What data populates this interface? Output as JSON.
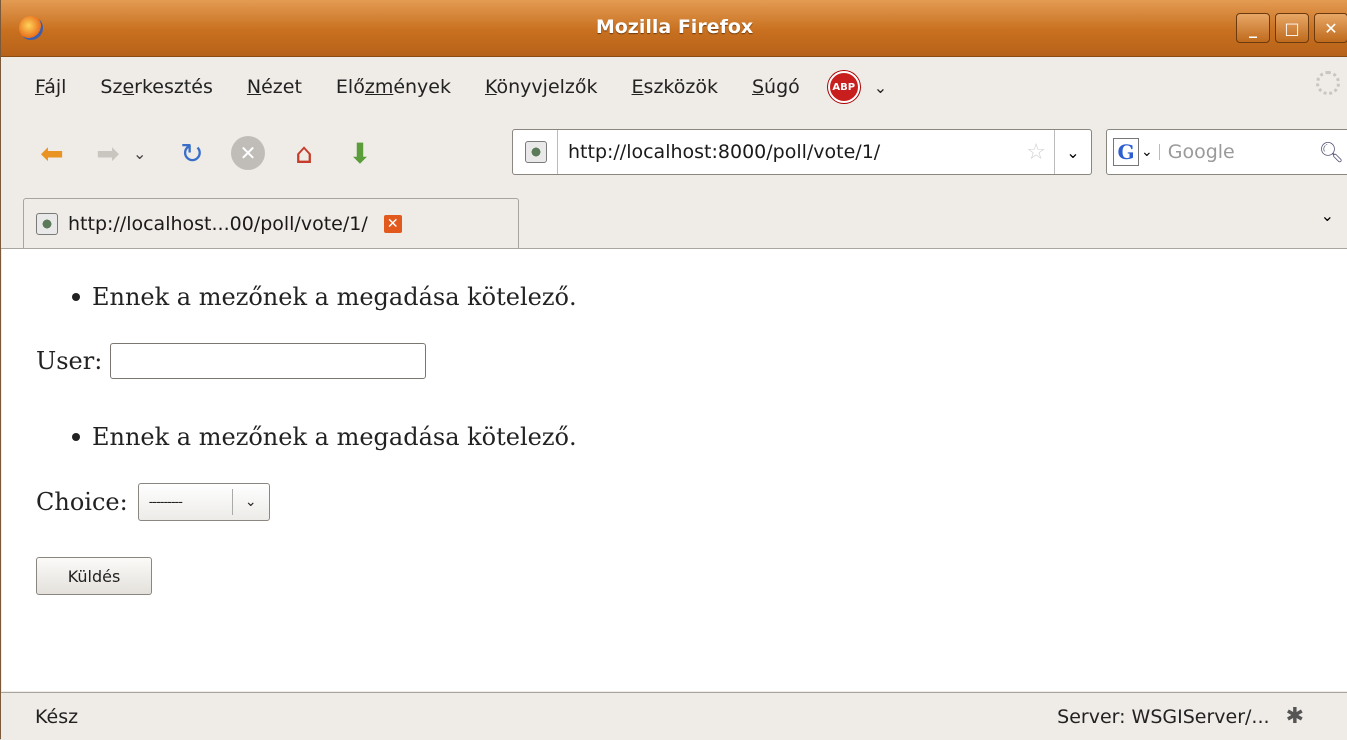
{
  "window": {
    "title": "Mozilla Firefox",
    "controls": {
      "minimize": "_",
      "maximize": "□",
      "close": "✕"
    }
  },
  "menubar": {
    "items": [
      {
        "pre": "",
        "u": "F",
        "post": "ájl"
      },
      {
        "pre": "Sz",
        "u": "e",
        "post": "rkesztés"
      },
      {
        "pre": "",
        "u": "N",
        "post": "ézet"
      },
      {
        "pre": "Elő",
        "u": "zm",
        "post": "ények"
      },
      {
        "pre": "",
        "u": "K",
        "post": "önyvjelzők"
      },
      {
        "pre": "",
        "u": "E",
        "post": "szközök"
      },
      {
        "pre": "",
        "u": "S",
        "post": "úgó"
      }
    ],
    "abp_label": "ABP"
  },
  "navbar": {
    "url": "http://localhost:8000/poll/vote/1/",
    "search_placeholder": "Google",
    "search_engine_letter": "G"
  },
  "tabs": [
    {
      "label": "http://localhost...00/poll/vote/1/",
      "close": "✕"
    }
  ],
  "page": {
    "error1": "Ennek a mezőnek a megadása kötelező.",
    "user_label": "User:",
    "user_value": "",
    "error2": "Ennek a mezőnek a megadása kötelező.",
    "choice_label": "Choice:",
    "choice_selected": "---------",
    "submit_label": "Küldés"
  },
  "statusbar": {
    "left": "Kész",
    "right": "Server: WSGIServer/..."
  }
}
